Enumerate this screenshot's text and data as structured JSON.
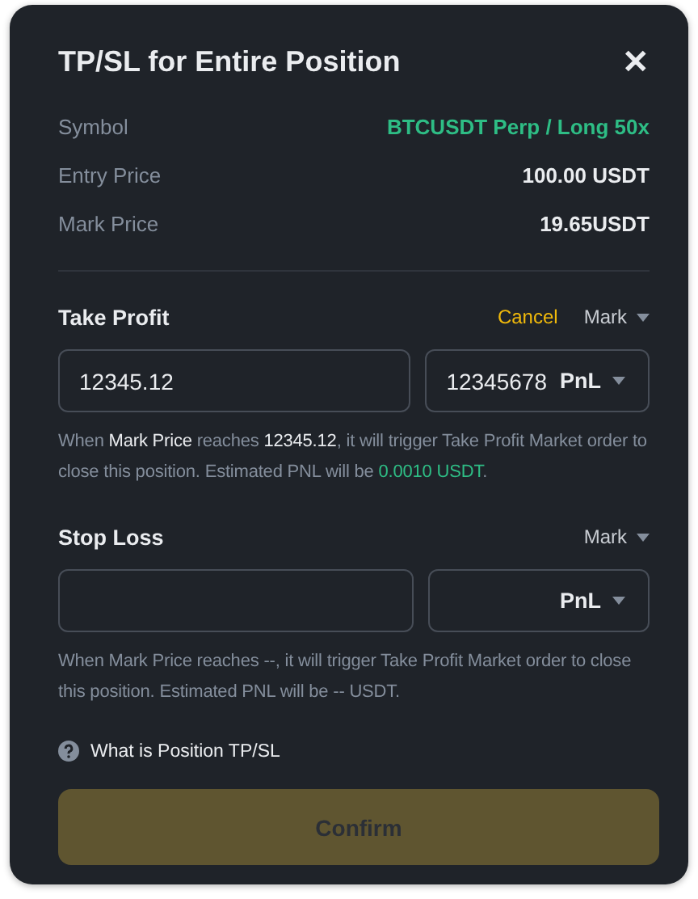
{
  "dialog": {
    "title": "TP/SL for Entire Position",
    "close": "✕"
  },
  "info": [
    {
      "label": "Symbol",
      "value": "BTCUSDT Perp / Long 50x",
      "kind": "accent"
    },
    {
      "label": "Entry Price",
      "value": "100.00 USDT",
      "kind": "plain"
    },
    {
      "label": "Mark Price",
      "value": "19.65USDT",
      "kind": "plain"
    }
  ],
  "sections": [
    {
      "title": "Take Profit",
      "cancel": "Cancel",
      "trigger": "Mark",
      "price": {
        "value": "12345.12"
      },
      "pnl": {
        "value": "12345678",
        "unit": "PnL"
      },
      "hint": [
        {
          "text": "When ",
          "kind": "plain"
        },
        {
          "text": "Mark Price",
          "kind": "strong"
        },
        {
          "text": " reaches ",
          "kind": "plain"
        },
        {
          "text": "12345.12",
          "kind": "strong"
        },
        {
          "text": ", it will trigger Take Profit Market order to close this position. Estimated PNL will be ",
          "kind": "plain"
        },
        {
          "text": "0.0010 USDT",
          "kind": "positive"
        },
        {
          "text": ".",
          "kind": "plain"
        }
      ]
    },
    {
      "title": "Stop Loss",
      "trigger": "Mark",
      "pnl": {
        "unit": "PnL"
      },
      "hint": [
        {
          "text": "When Mark Price reaches --, it will trigger Take Profit Market order to close this position. Estimated PNL will be -- USDT.",
          "kind": "plain"
        }
      ]
    }
  ],
  "help": {
    "label": "What is Position TP/SL"
  },
  "confirm": {
    "label": "Confirm",
    "disabled": true
  }
}
